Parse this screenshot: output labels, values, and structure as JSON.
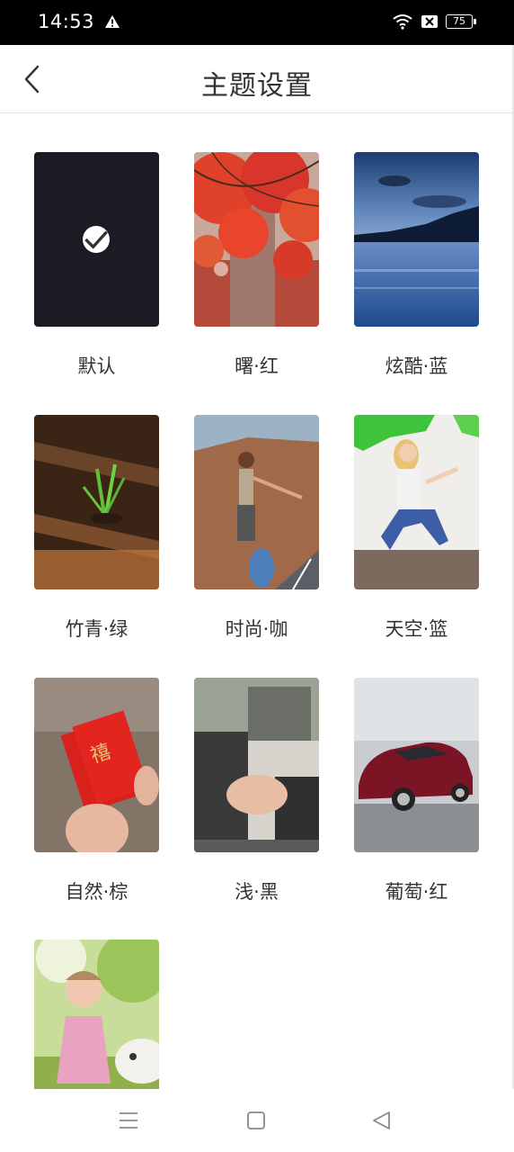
{
  "status_bar": {
    "time": "14:53",
    "battery": "75",
    "icons": [
      "warning-icon",
      "wifi-icon",
      "no-sim-icon",
      "battery-icon"
    ]
  },
  "header": {
    "title": "主题设置",
    "back_icon": "back-chevron-icon"
  },
  "themes": [
    {
      "label": "默认",
      "selected": true,
      "color": "#1b1b23"
    },
    {
      "label": "曙·红",
      "selected": false,
      "color": "#d8432c"
    },
    {
      "label": "炫酷·蓝",
      "selected": false,
      "color": "#2a5d9c"
    },
    {
      "label": "竹青·绿",
      "selected": false,
      "color": "#5c3a22"
    },
    {
      "label": "时尚·咖",
      "selected": false,
      "color": "#a7795a"
    },
    {
      "label": "天空·篮",
      "selected": false,
      "color": "#e9e6e1"
    },
    {
      "label": "自然·棕",
      "selected": false,
      "color": "#8a7c71"
    },
    {
      "label": "浅·黑",
      "selected": false,
      "color": "#3a3a3a"
    },
    {
      "label": "葡萄·红",
      "selected": false,
      "color": "#7a1525"
    },
    {
      "label": "",
      "selected": false,
      "color": "#a3c56a"
    }
  ],
  "nav_bar": {
    "icons": [
      "menu-icon",
      "home-icon",
      "back-triangle-icon"
    ]
  }
}
